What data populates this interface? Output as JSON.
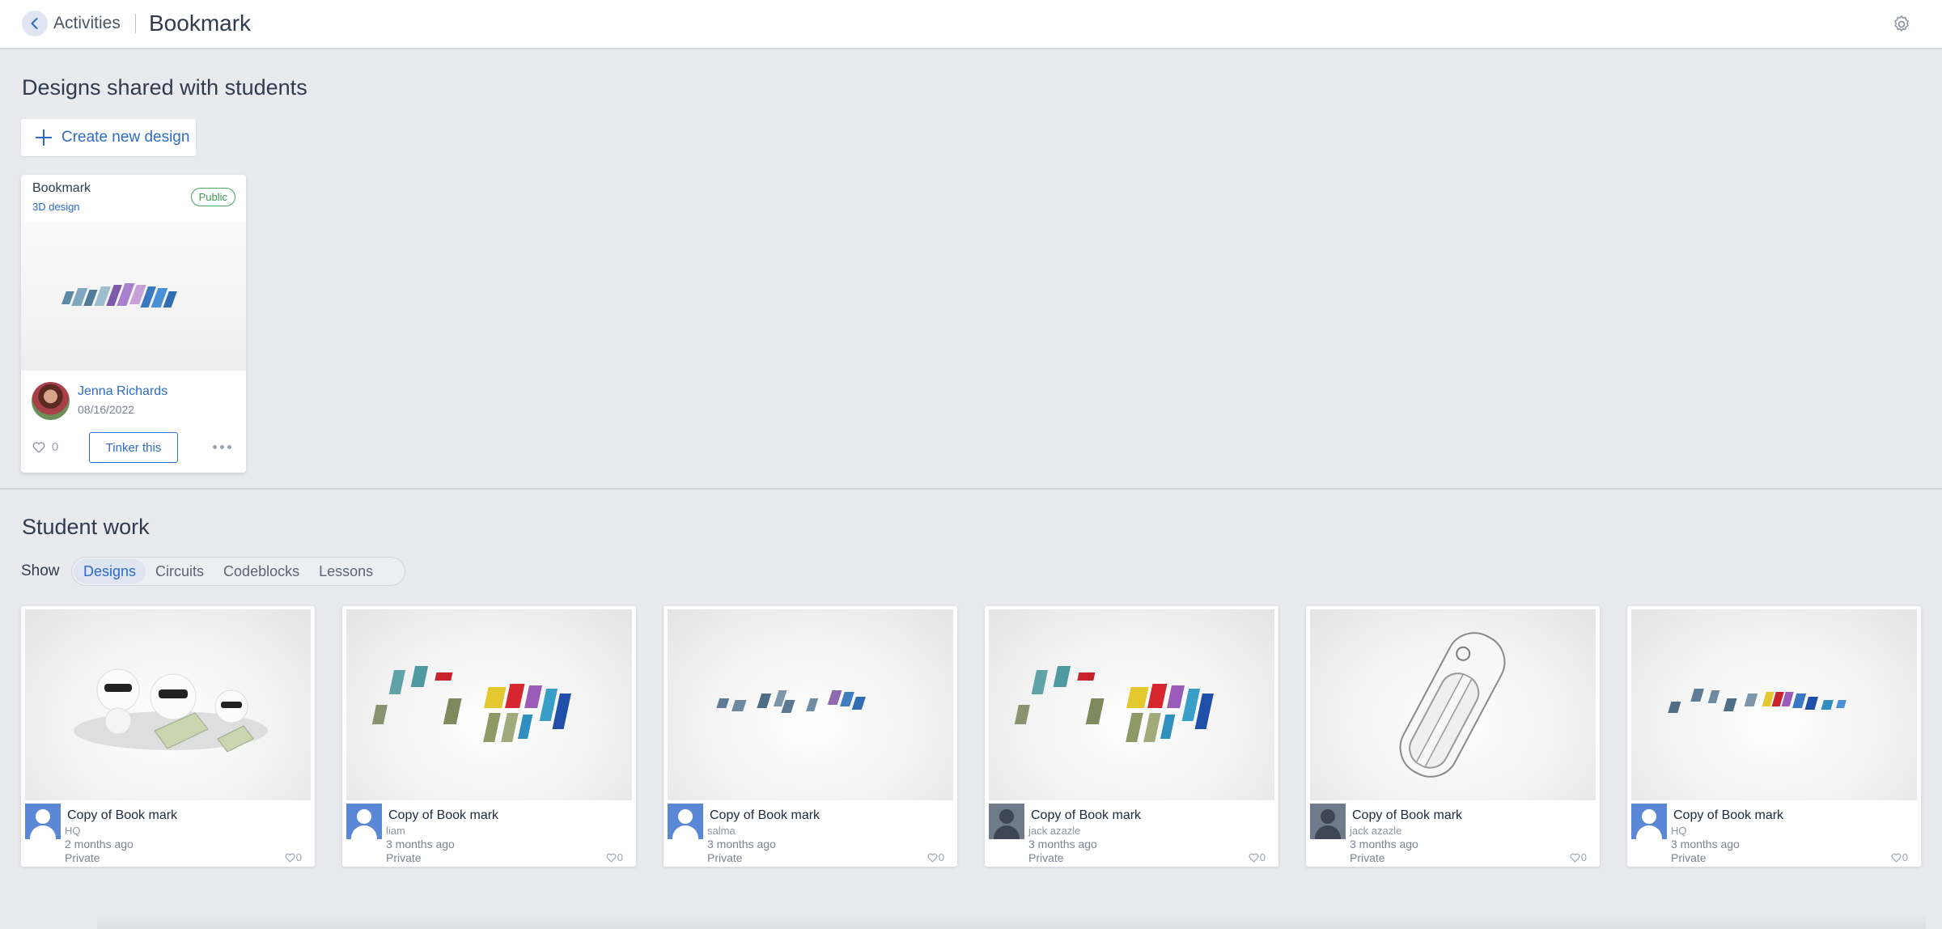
{
  "header": {
    "back_icon": "chevron-left-icon",
    "breadcrumb_parent": "Activities",
    "title": "Bookmark",
    "settings_icon": "gear-icon"
  },
  "shared_section": {
    "title": "Designs shared with students",
    "create_label": "Create new design",
    "card": {
      "name": "Bookmark",
      "type": "3D design",
      "badge": "Public",
      "author": "Jenna Richards",
      "date": "08/16/2022",
      "likes": "0",
      "tinker_label": "Tinker this"
    }
  },
  "student_section": {
    "title": "Student work",
    "show_label": "Show",
    "filters": [
      "Designs",
      "Circuits",
      "Codeblocks",
      "Lessons"
    ],
    "active_filter": "Designs",
    "cards": [
      {
        "title": "Copy of Book mark",
        "owner": "HQ",
        "time": "2 months ago",
        "visibility": "Private",
        "likes": "0",
        "avatar": "blue"
      },
      {
        "title": "Copy of Book mark",
        "owner": "liam",
        "time": "3 months ago",
        "visibility": "Private",
        "likes": "0",
        "avatar": "blue"
      },
      {
        "title": "Copy of Book mark",
        "owner": "salma",
        "time": "3 months ago",
        "visibility": "Private",
        "likes": "0",
        "avatar": "blue"
      },
      {
        "title": "Copy of Book mark",
        "owner": "jack azazle",
        "time": "3 months ago",
        "visibility": "Private",
        "likes": "0",
        "avatar": "dark"
      },
      {
        "title": "Copy of Book mark",
        "owner": "jack azazle",
        "time": "3 months ago",
        "visibility": "Private",
        "likes": "0",
        "avatar": "dark"
      },
      {
        "title": "Copy of Book mark",
        "owner": "HQ",
        "time": "3 months ago",
        "visibility": "Private",
        "likes": "0",
        "avatar": "blue"
      }
    ]
  },
  "colors": {
    "accent": "#2d6bc8",
    "public_badge": "#3b9a4f",
    "background": "#e8eaee"
  }
}
